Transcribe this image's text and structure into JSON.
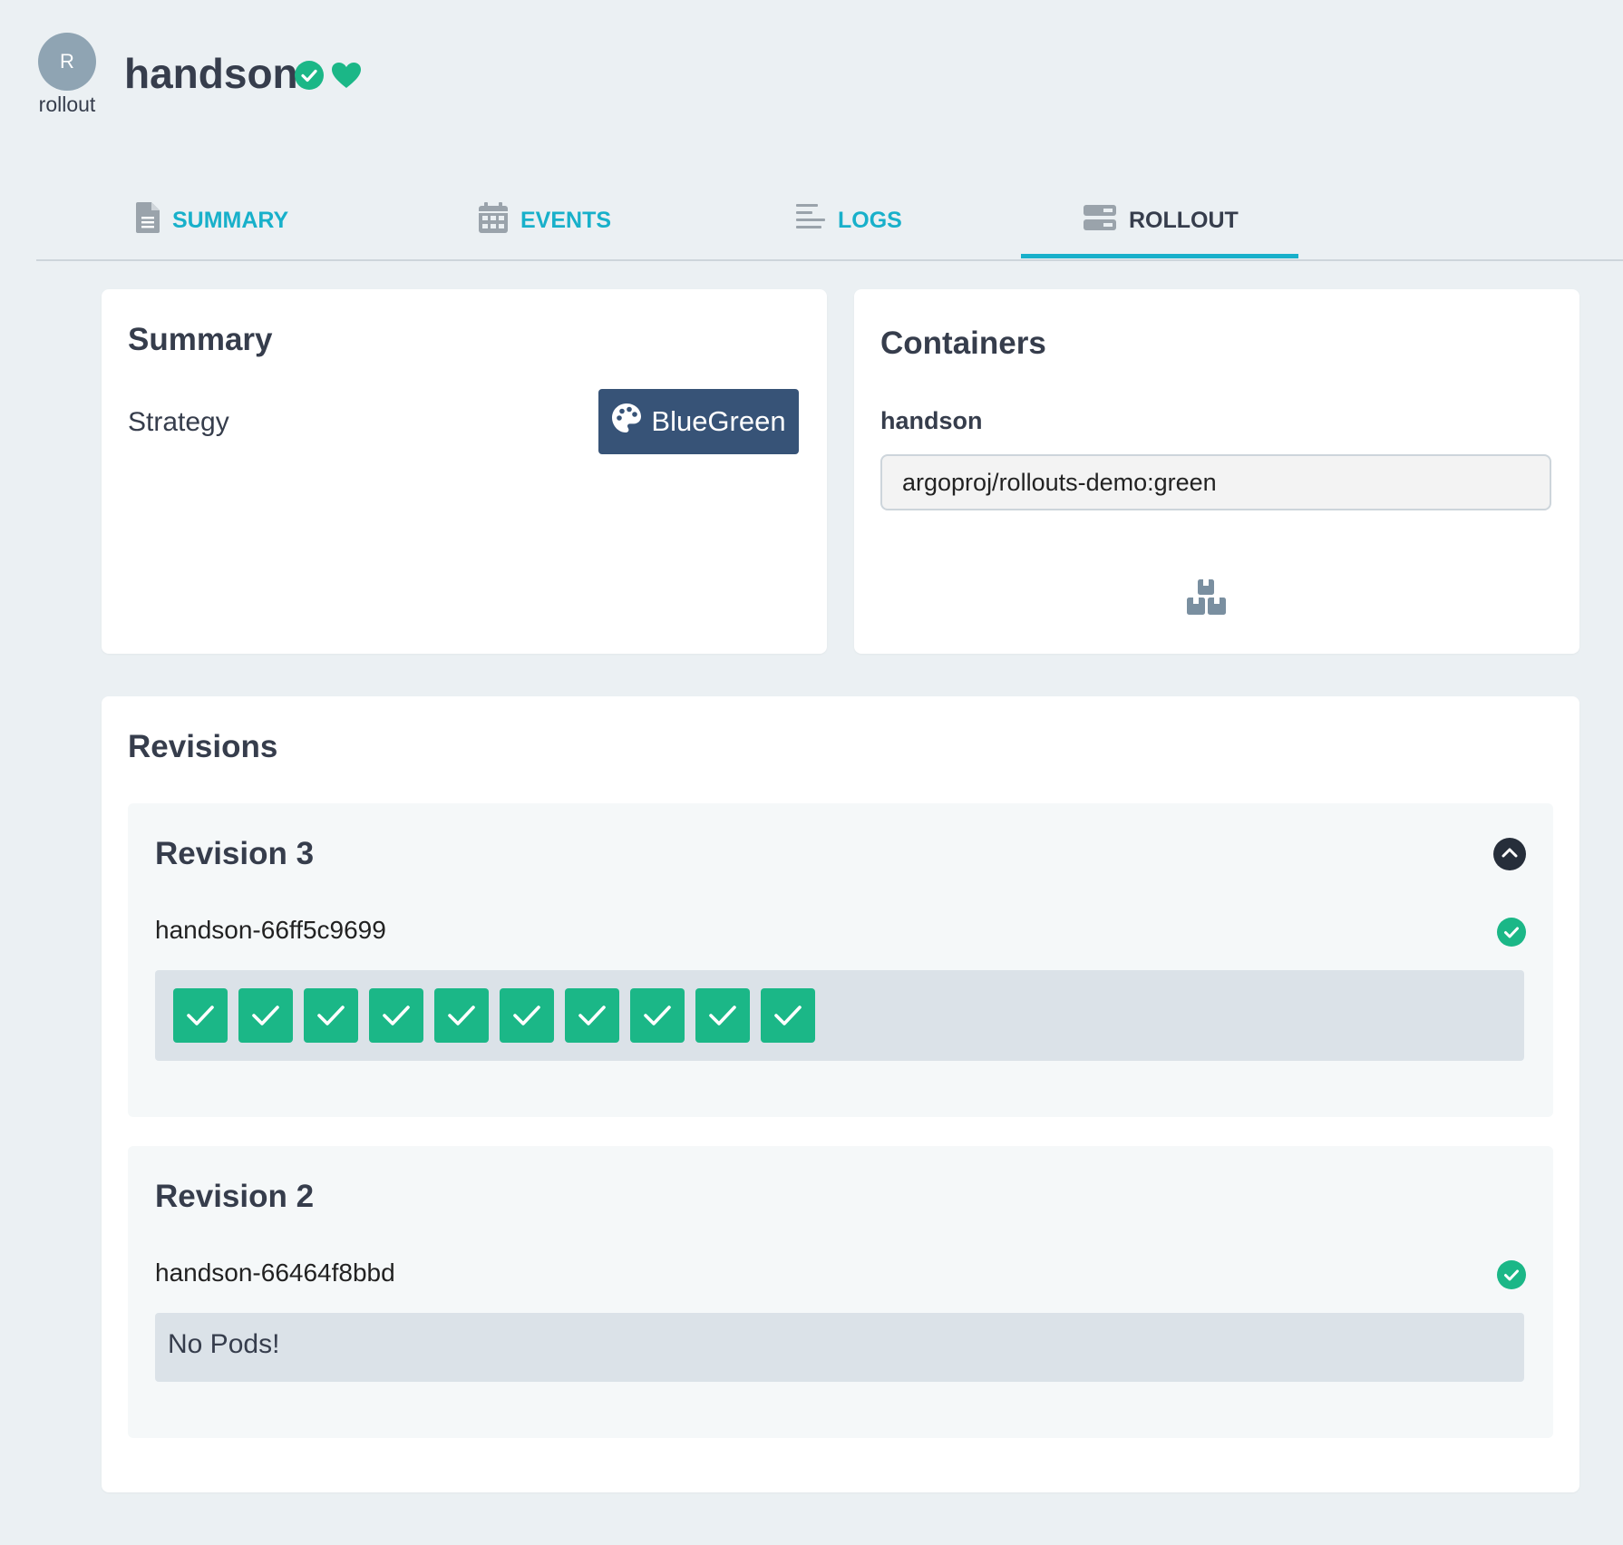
{
  "header": {
    "kind_avatar": "R",
    "kind_label": "rollout",
    "app_name": "handson"
  },
  "tabs": [
    {
      "label": "SUMMARY",
      "icon": "file-icon",
      "active": false
    },
    {
      "label": "EVENTS",
      "icon": "calendar-icon",
      "active": false
    },
    {
      "label": "LOGS",
      "icon": "logs-icon",
      "active": false
    },
    {
      "label": "ROLLOUT",
      "icon": "rollout-icon",
      "active": true
    }
  ],
  "summary": {
    "title": "Summary",
    "strategy_label": "Strategy",
    "strategy_value": "BlueGreen"
  },
  "containers": {
    "title": "Containers",
    "items": [
      {
        "name": "handson",
        "image": "argoproj/rollouts-demo:green"
      }
    ]
  },
  "revisions": {
    "title": "Revisions",
    "items": [
      {
        "title": "Revision 3",
        "replicaset": "handson-66ff5c9699",
        "pod_count": 10,
        "expanded": true
      },
      {
        "title": "Revision 2",
        "replicaset": "handson-66464f8bbd",
        "pod_count": 0,
        "empty_text": "No Pods!"
      }
    ]
  },
  "colors": {
    "accent": "#18b0ca",
    "healthy": "#1bb787",
    "strategy_badge": "#375377",
    "background": "#ebf0f3"
  }
}
